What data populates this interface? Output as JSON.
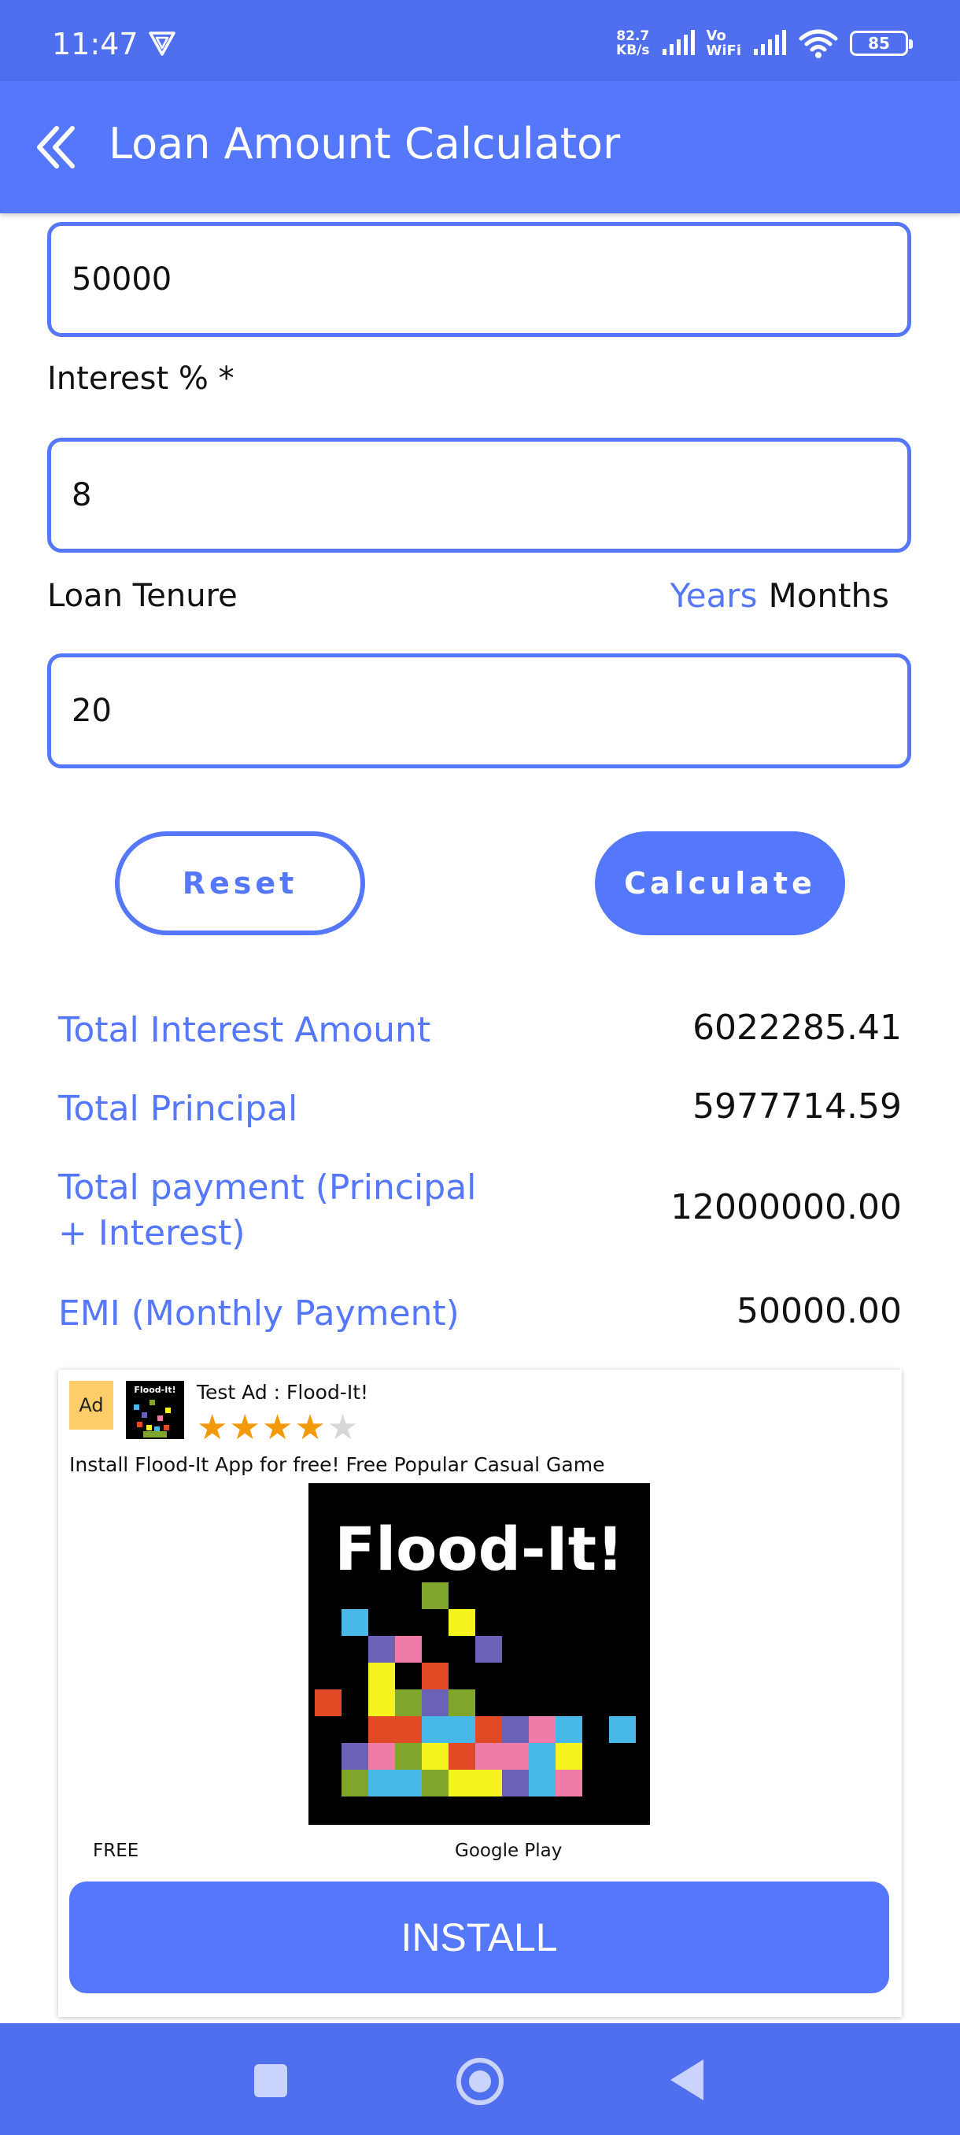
{
  "status_bar": {
    "time": "11:47",
    "speed_value": "82.7",
    "speed_unit": "KB/s",
    "vo": "Vo",
    "wifi_label": "WiFi",
    "battery": "85"
  },
  "app_bar": {
    "title": "Loan Amount Calculator",
    "back_icon": "double-chevron-left-icon"
  },
  "form": {
    "amount_value": "50000",
    "interest_label": "Interest % *",
    "interest_value": "8",
    "tenure_label": "Loan Tenure",
    "tenure_unit_years": "Years",
    "tenure_unit_months": "Months",
    "tenure_value": "20"
  },
  "buttons": {
    "reset": "Reset",
    "calculate": "Calculate"
  },
  "results": [
    {
      "label": "Total Interest Amount",
      "value": "6022285.41"
    },
    {
      "label": "Total Principal",
      "value": "5977714.59"
    },
    {
      "label": "Total payment (Principal + Interest)",
      "value": "12000000.00"
    },
    {
      "label": "EMI (Monthly Payment)",
      "value": "50000.00"
    }
  ],
  "ad": {
    "badge": "Ad",
    "title": "Test Ad : Flood-It!",
    "rating": 4,
    "rating_max": 5,
    "description": "Install Flood-It App for free! Free Popular Casual Game",
    "image_text": "Flood-It!",
    "icon_text": "Flood-It!",
    "price": "FREE",
    "store": "Google Play",
    "install": "INSTALL"
  },
  "colors": {
    "accent": "#5577fb",
    "status_bar": "#4f6fef",
    "ad_badge": "#fccd68",
    "star": "#f29a0c"
  }
}
